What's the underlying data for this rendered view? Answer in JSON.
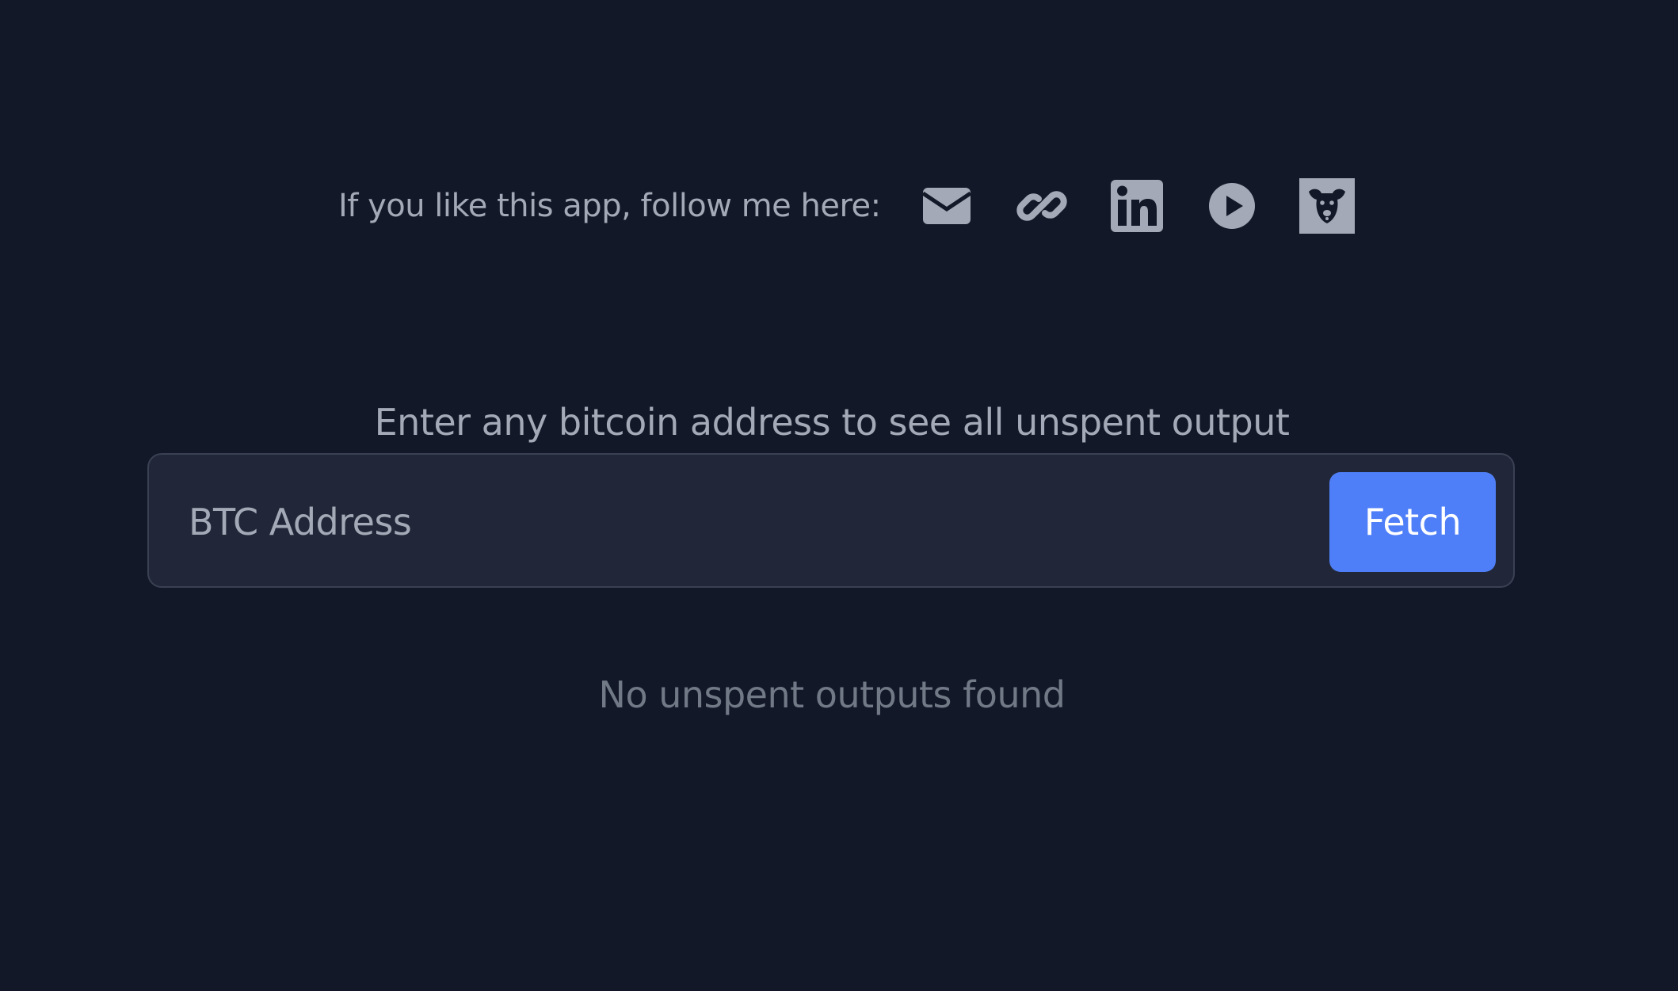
{
  "follow": {
    "text": "If you like this app, follow me here:",
    "links": [
      {
        "icon": "envelope-icon"
      },
      {
        "icon": "link-icon"
      },
      {
        "icon": "linkedin-icon"
      },
      {
        "icon": "youtube-play-icon"
      },
      {
        "icon": "dog-mascot-icon"
      }
    ],
    "icon_color": "#a3a9b6"
  },
  "main": {
    "prompt": "Enter any bitcoin address to see all unspent output",
    "input_placeholder": "BTC Address",
    "input_value": "",
    "fetch_label": "Fetch",
    "status": "No unspent outputs found"
  },
  "colors": {
    "background": "#131828",
    "panel": "#212738",
    "accent": "#4f7ff8"
  }
}
